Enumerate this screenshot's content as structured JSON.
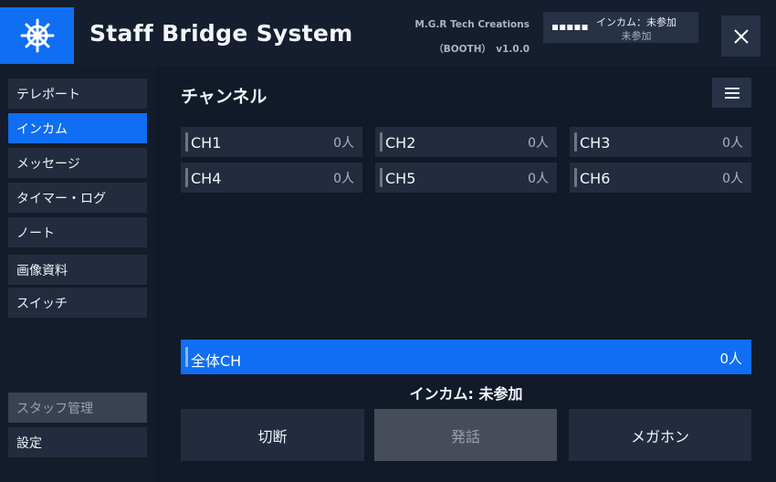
{
  "header": {
    "app_title": "Staff Bridge System",
    "credit_line1": "M.G.R Tech Creations",
    "credit_line2": "（BOOTH）　v1.0.0",
    "status_dots": "▪▪▪▪▪",
    "status_line1": "インカム：未参加",
    "status_line2": "未参加",
    "logo_icon": "ship-wheel-icon",
    "close_icon": "close-icon"
  },
  "sidebar": {
    "items": [
      {
        "label": "テレポート",
        "state": "normal"
      },
      {
        "label": "インカム",
        "state": "active"
      },
      {
        "label": "メッセージ",
        "state": "normal"
      },
      {
        "label": "タイマー・ログ",
        "state": "normal"
      },
      {
        "label": "ノート",
        "state": "normal"
      },
      {
        "label": "画像資料",
        "state": "normal"
      },
      {
        "label": "スイッチ",
        "state": "normal"
      }
    ],
    "bottom_items": [
      {
        "label": "スタッフ管理",
        "state": "disabled"
      },
      {
        "label": "設定",
        "state": "normal"
      }
    ]
  },
  "main": {
    "title": "チャンネル",
    "menu_icon": "hamburger-menu-icon",
    "channels": [
      {
        "name": "CH1",
        "count": "0人"
      },
      {
        "name": "CH2",
        "count": "0人"
      },
      {
        "name": "CH3",
        "count": "0人"
      },
      {
        "name": "CH4",
        "count": "0人"
      },
      {
        "name": "CH5",
        "count": "0人"
      },
      {
        "name": "CH6",
        "count": "0人"
      }
    ],
    "all_channel": {
      "name": "全体CH",
      "count": "0人"
    },
    "intercom_status": "インカム: 未参加",
    "actions": {
      "disconnect": "切断",
      "speak": "発話",
      "megaphone": "メガホン"
    }
  },
  "colors": {
    "accent": "#0f6ef2",
    "background": "#111a29",
    "panel": "#222c3e",
    "disabled": "#474d58"
  }
}
